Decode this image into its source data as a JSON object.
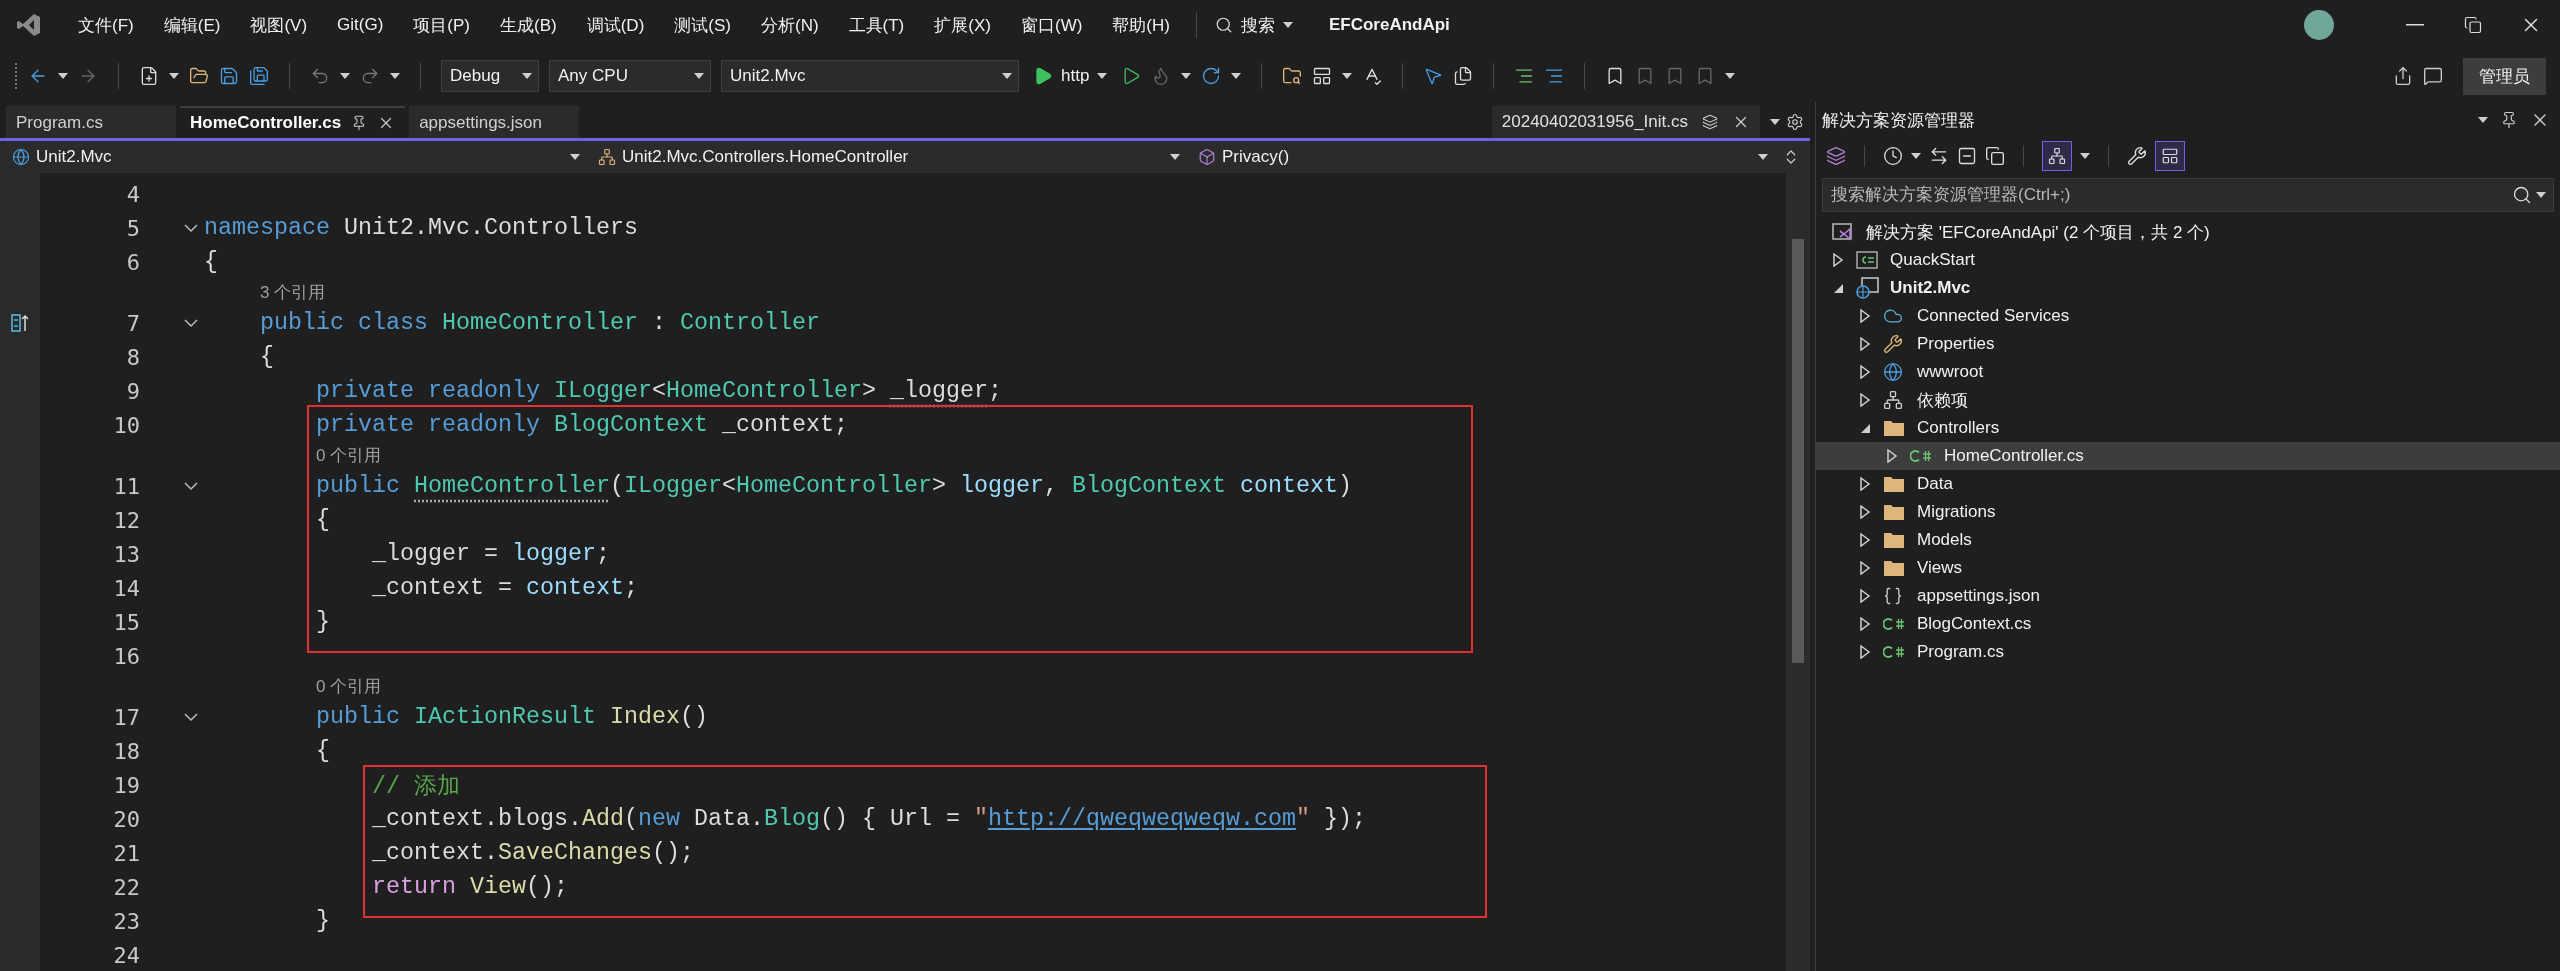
{
  "menu_bar": {
    "items": [
      "文件(F)",
      "编辑(E)",
      "视图(V)",
      "Git(G)",
      "项目(P)",
      "生成(B)",
      "调试(D)",
      "测试(S)",
      "分析(N)",
      "工具(T)",
      "扩展(X)",
      "窗口(W)",
      "帮助(H)"
    ],
    "search_label": "搜索",
    "solution_name": "EFCoreAndApi"
  },
  "toolbar": {
    "configuration": "Debug",
    "platform": "Any CPU",
    "startup_project": "Unit2.Mvc",
    "launch_profile": "http",
    "admin_label": "管理员"
  },
  "editor": {
    "tabs": [
      {
        "label": "Program.cs",
        "selected": false
      },
      {
        "label": "HomeController.cs",
        "selected": true
      },
      {
        "label": "appsettings.json",
        "selected": false
      }
    ],
    "preview_tab": {
      "label": "20240402031956_Init.cs"
    },
    "nav_bar": {
      "project": "Unit2.Mvc",
      "type": "Unit2.Mvc.Controllers.HomeController",
      "member": "Privacy()"
    },
    "lines": [
      {
        "number": "4"
      },
      {
        "number": "5",
        "expanded": true,
        "tokens": [
          {
            "kind": "keyword",
            "t": "namespace"
          },
          {
            "kind": "plain",
            "t": " Unit2.Mvc.Controllers"
          }
        ]
      },
      {
        "number": "6",
        "tokens": [
          {
            "kind": "plain",
            "t": "{"
          }
        ]
      },
      {
        "number": "7",
        "expanded": true,
        "margin_icon": true,
        "codelens": "3 个引用",
        "tokens": [
          {
            "kind": "keyword",
            "t": "    public class"
          },
          {
            "kind": "type",
            "t": " HomeController"
          },
          {
            "kind": "plain",
            "t": " : "
          },
          {
            "kind": "type",
            "t": "Controller"
          }
        ]
      },
      {
        "number": "8",
        "tokens": [
          {
            "kind": "plain",
            "t": "    {"
          }
        ]
      },
      {
        "number": "9",
        "tokens": [
          {
            "kind": "keyword",
            "t": "        private readonly"
          },
          {
            "kind": "type",
            "t": " ILogger"
          },
          {
            "kind": "plain",
            "t": "<"
          },
          {
            "kind": "type",
            "t": "HomeController"
          },
          {
            "kind": "plain",
            "t": "> "
          },
          {
            "kind": "plain",
            "t": "_logger",
            "hint": true
          },
          {
            "kind": "plain",
            "t": ";"
          }
        ]
      },
      {
        "number": "10",
        "boxed": true,
        "tokens": [
          {
            "kind": "keyword",
            "t": "        private readonly"
          },
          {
            "kind": "type",
            "t": " BlogContext"
          },
          {
            "kind": "plain",
            "t": " _context;"
          }
        ]
      },
      {
        "number": "11",
        "boxed": true,
        "expanded": true,
        "codelens": "0 个引用",
        "tokens": [
          {
            "kind": "keyword",
            "t": "        public "
          },
          {
            "kind": "type",
            "t": "HomeController",
            "hint": true
          },
          {
            "kind": "plain",
            "t": "("
          },
          {
            "kind": "type",
            "t": "ILogger"
          },
          {
            "kind": "plain",
            "t": "<"
          },
          {
            "kind": "type",
            "t": "HomeController"
          },
          {
            "kind": "plain",
            "t": "> "
          },
          {
            "kind": "variable",
            "t": "logger"
          },
          {
            "kind": "plain",
            "t": ", "
          },
          {
            "kind": "type",
            "t": "BlogContext"
          },
          {
            "kind": "variable",
            "t": " context"
          },
          {
            "kind": "plain",
            "t": ")"
          }
        ]
      },
      {
        "number": "12",
        "boxed": true,
        "tokens": [
          {
            "kind": "plain",
            "t": "        {"
          }
        ]
      },
      {
        "number": "13",
        "boxed": true,
        "tokens": [
          {
            "kind": "plain",
            "t": "            _logger = "
          },
          {
            "kind": "variable",
            "t": "logger"
          },
          {
            "kind": "plain",
            "t": ";"
          }
        ]
      },
      {
        "number": "14",
        "boxed": true,
        "tokens": [
          {
            "kind": "plain",
            "t": "            _context = "
          },
          {
            "kind": "variable",
            "t": "context"
          },
          {
            "kind": "plain",
            "t": ";"
          }
        ]
      },
      {
        "number": "15",
        "boxed": true,
        "tokens": [
          {
            "kind": "plain",
            "t": "        }"
          }
        ]
      },
      {
        "number": "16"
      },
      {
        "number": "17",
        "expanded": true,
        "codelens": "0 个引用",
        "tokens": [
          {
            "kind": "keyword",
            "t": "        public"
          },
          {
            "kind": "type",
            "t": " IActionResult"
          },
          {
            "kind": "method",
            "t": " Index"
          },
          {
            "kind": "plain",
            "t": "()"
          }
        ]
      },
      {
        "number": "18",
        "tokens": [
          {
            "kind": "plain",
            "t": "        {"
          }
        ]
      },
      {
        "number": "19",
        "boxed": true,
        "tokens": [
          {
            "kind": "comment",
            "t": "            // 添加"
          }
        ]
      },
      {
        "number": "20",
        "boxed": true,
        "tokens": [
          {
            "kind": "plain",
            "t": "            _context.blogs."
          },
          {
            "kind": "method",
            "t": "Add"
          },
          {
            "kind": "plain",
            "t": "("
          },
          {
            "kind": "keyword",
            "t": "new"
          },
          {
            "kind": "plain",
            "t": " Data."
          },
          {
            "kind": "type",
            "t": "Blog"
          },
          {
            "kind": "plain",
            "t": "() { Url = "
          },
          {
            "kind": "string",
            "t": "\""
          },
          {
            "kind": "link",
            "t": "http://qweqweqweqw.com"
          },
          {
            "kind": "string",
            "t": "\""
          },
          {
            "kind": "plain",
            "t": " });"
          }
        ]
      },
      {
        "number": "21",
        "boxed": true,
        "tokens": [
          {
            "kind": "plain",
            "t": "            _context."
          },
          {
            "kind": "method",
            "t": "SaveChanges"
          },
          {
            "kind": "plain",
            "t": "();"
          }
        ]
      },
      {
        "number": "22",
        "boxed": true,
        "tokens": [
          {
            "kind": "control",
            "t": "            return"
          },
          {
            "kind": "method",
            "t": " View"
          },
          {
            "kind": "plain",
            "t": "();"
          }
        ]
      },
      {
        "number": "23",
        "tokens": [
          {
            "kind": "plain",
            "t": "        }"
          }
        ]
      },
      {
        "number": "24"
      }
    ]
  },
  "solution_explorer": {
    "title": "解决方案资源管理器",
    "toolbar_toggles": [
      {
        "on": true
      },
      {
        "on": true
      }
    ],
    "search_placeholder": "搜索解决方案资源管理器(Ctrl+;)",
    "solution": "解决方案 'EFCoreAndApi' (2 个项目，共 2 个)",
    "items": [
      {
        "label": "QuackStart",
        "kind": "project",
        "startup": false,
        "expanded": false,
        "selected": false
      },
      {
        "label": "Unit2.Mvc",
        "kind": "web-project",
        "startup": true,
        "expanded": true,
        "selected": false,
        "children": [
          {
            "label": "Connected Services",
            "kind": "connected",
            "expanded": false,
            "selected": false
          },
          {
            "label": "Properties",
            "kind": "properties",
            "expanded": false,
            "selected": false
          },
          {
            "label": "wwwroot",
            "kind": "web-root",
            "expanded": false,
            "selected": false
          },
          {
            "label": "依赖项",
            "kind": "dependencies",
            "expanded": false,
            "selected": false
          },
          {
            "label": "Controllers",
            "kind": "folder",
            "expanded": true,
            "selected": false,
            "children": [
              {
                "label": "HomeController.cs",
                "kind": "csharp",
                "expanded": false,
                "selected": true
              }
            ]
          },
          {
            "label": "Data",
            "kind": "folder",
            "expanded": false,
            "selected": false
          },
          {
            "label": "Migrations",
            "kind": "folder",
            "expanded": false,
            "selected": false
          },
          {
            "label": "Models",
            "kind": "folder",
            "expanded": false,
            "selected": false
          },
          {
            "label": "Views",
            "kind": "folder",
            "expanded": false,
            "selected": false
          },
          {
            "label": "appsettings.json",
            "kind": "json",
            "expanded": false,
            "selected": false
          },
          {
            "label": "BlogContext.cs",
            "kind": "csharp",
            "expanded": false,
            "selected": false
          },
          {
            "label": "Program.cs",
            "kind": "csharp",
            "expanded": false,
            "selected": false
          }
        ]
      }
    ]
  }
}
